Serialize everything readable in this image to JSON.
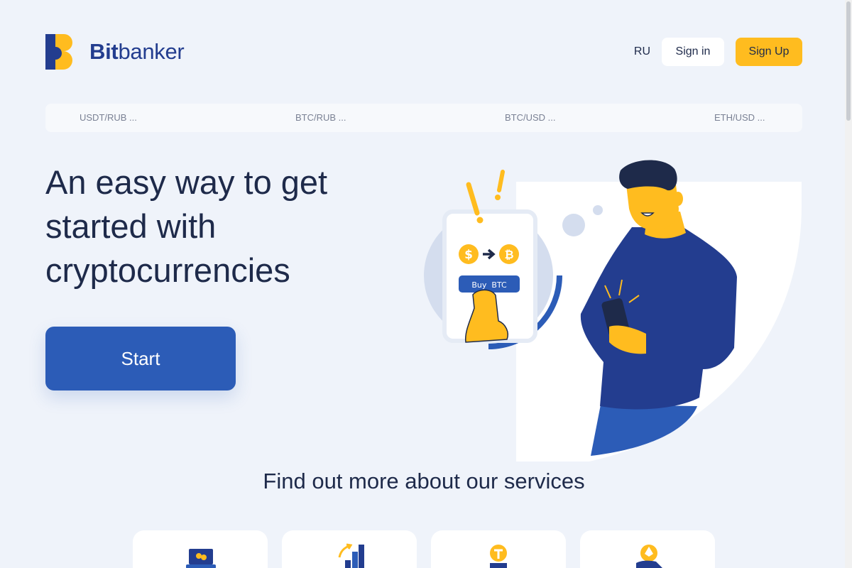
{
  "header": {
    "brand_bold": "Bit",
    "brand_rest": "banker",
    "lang": "RU",
    "signin_label": "Sign in",
    "signup_label": "Sign Up"
  },
  "ticker": [
    "USDT/RUB ...",
    "BTC/RUB ...",
    "BTC/USD ...",
    "ETH/USD ..."
  ],
  "hero": {
    "title": "An easy way to get started with cryptocurrencies",
    "start_label": "Start",
    "phone_button": "Buy  BTC"
  },
  "services": {
    "title": "Find out more about our services",
    "cards": [
      {
        "icon": "laptop-coins-icon"
      },
      {
        "icon": "growth-chart-icon"
      },
      {
        "icon": "tether-coin-hand-icon"
      },
      {
        "icon": "ethereum-coin-hand-icon"
      }
    ]
  },
  "colors": {
    "background": "#eff3fa",
    "brand_blue": "#2c5cb7",
    "accent_yellow": "#ffbc1f",
    "text_dark": "#1e2a4a"
  }
}
